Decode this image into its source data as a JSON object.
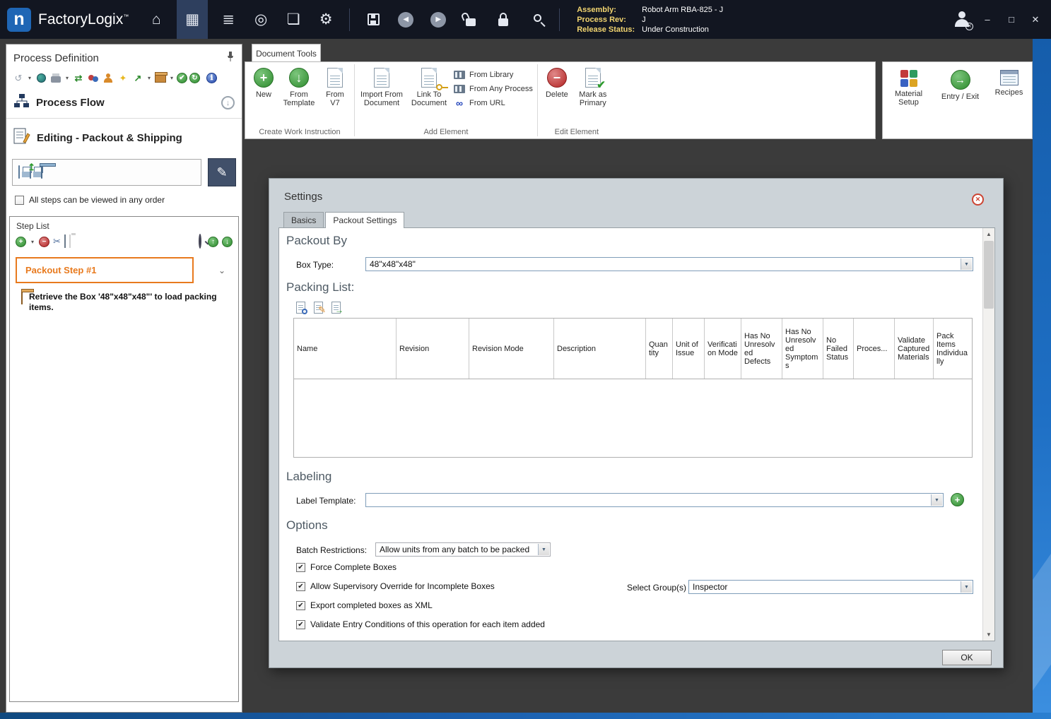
{
  "titlebar": {
    "logo_letter": "n",
    "app_name": "FactoryLogix",
    "trademark": "™",
    "assembly": {
      "label": "Assembly:",
      "value": "Robot Arm RBA-825 - J"
    },
    "process_rev": {
      "label": "Process Rev:",
      "value": "J"
    },
    "release_status": {
      "label": "Release Status:",
      "value": "Under Construction"
    },
    "window_controls": {
      "minimize": "–",
      "maximize": "□",
      "close": "✕"
    }
  },
  "sidebar": {
    "title": "Process Definition",
    "process_flow_label": "Process Flow",
    "editing_label": "Editing - Packout & Shipping",
    "order_checkbox_label": "All steps can be viewed in any order",
    "order_checkbox_checked": false,
    "step_list": {
      "title": "Step List",
      "selected_step": "Packout Step #1",
      "step_description": "Retrieve the Box '48\"x48\"x48\"' to load packing items."
    }
  },
  "ribbon": {
    "tab_label": "Document Tools",
    "create_group": {
      "label": "Create Work Instruction",
      "new_btn": "New",
      "from_template_btn": "From Template",
      "from_v7_btn": "From V7"
    },
    "add_group": {
      "label": "Add Element",
      "import_btn": "Import From Document",
      "link_btn": "Link To Document",
      "from_library_btn": "From Library",
      "from_any_process_btn": "From Any Process",
      "from_url_btn": "From URL"
    },
    "edit_group": {
      "label": "Edit Element",
      "delete_btn": "Delete",
      "mark_primary_btn": "Mark as Primary"
    },
    "side_group": {
      "material_setup_btn": "Material Setup",
      "entry_exit_btn": "Entry / Exit",
      "recipes_btn": "Recipes"
    }
  },
  "dialog": {
    "title": "Settings",
    "tabs": [
      {
        "label": "Basics"
      },
      {
        "label": "Packout Settings"
      }
    ],
    "active_tab": "Packout Settings",
    "packout_by": {
      "heading": "Packout By",
      "box_type_label": "Box Type:",
      "box_type_value": "48\"x48\"x48\""
    },
    "packing_list": {
      "heading": "Packing List:",
      "columns": [
        "Name",
        "Revision",
        "Revision Mode",
        "Description",
        "Quantity",
        "Unit of Issue",
        "Verification Mode",
        "Has No Unresolved Defects",
        "Has No Unresolved Symptoms",
        "No Failed Status",
        "Proces...",
        "Validate Captured Materials",
        "Pack Items Individually"
      ],
      "rows": []
    },
    "labeling": {
      "heading": "Labeling",
      "label_template_label": "Label Template:",
      "label_template_value": ""
    },
    "options": {
      "heading": "Options",
      "batch_restrictions_label": "Batch Restrictions:",
      "batch_restrictions_value": "Allow units from any batch to be packed",
      "checkboxes": [
        {
          "label": "Force Complete Boxes",
          "checked": true
        },
        {
          "label": "Allow Supervisory Override for Incomplete Boxes",
          "checked": true
        },
        {
          "label": "Export completed boxes as XML",
          "checked": true
        },
        {
          "label": "Validate Entry Conditions of this operation for each item added",
          "checked": true
        }
      ],
      "select_groups_label": "Select Group(s)",
      "select_groups_value": "Inspector"
    },
    "ok_label": "OK"
  }
}
